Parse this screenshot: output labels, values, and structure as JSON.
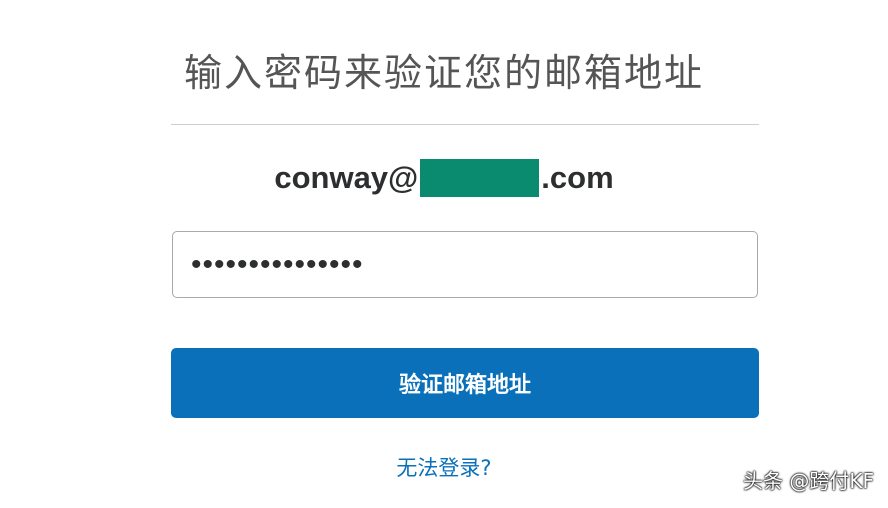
{
  "page": {
    "title": "输入密码来验证您的邮箱地址"
  },
  "account": {
    "email_prefix": "conway@",
    "email_suffix": ".com"
  },
  "password": {
    "masked_value": "•••••••••••••••"
  },
  "actions": {
    "verify_label": "验证邮箱地址",
    "help_link_label": "无法登录?"
  },
  "watermark": {
    "text": "头条 @跨付KF"
  },
  "colors": {
    "accent": "#0a70ba",
    "redaction": "#0a8a6e"
  }
}
